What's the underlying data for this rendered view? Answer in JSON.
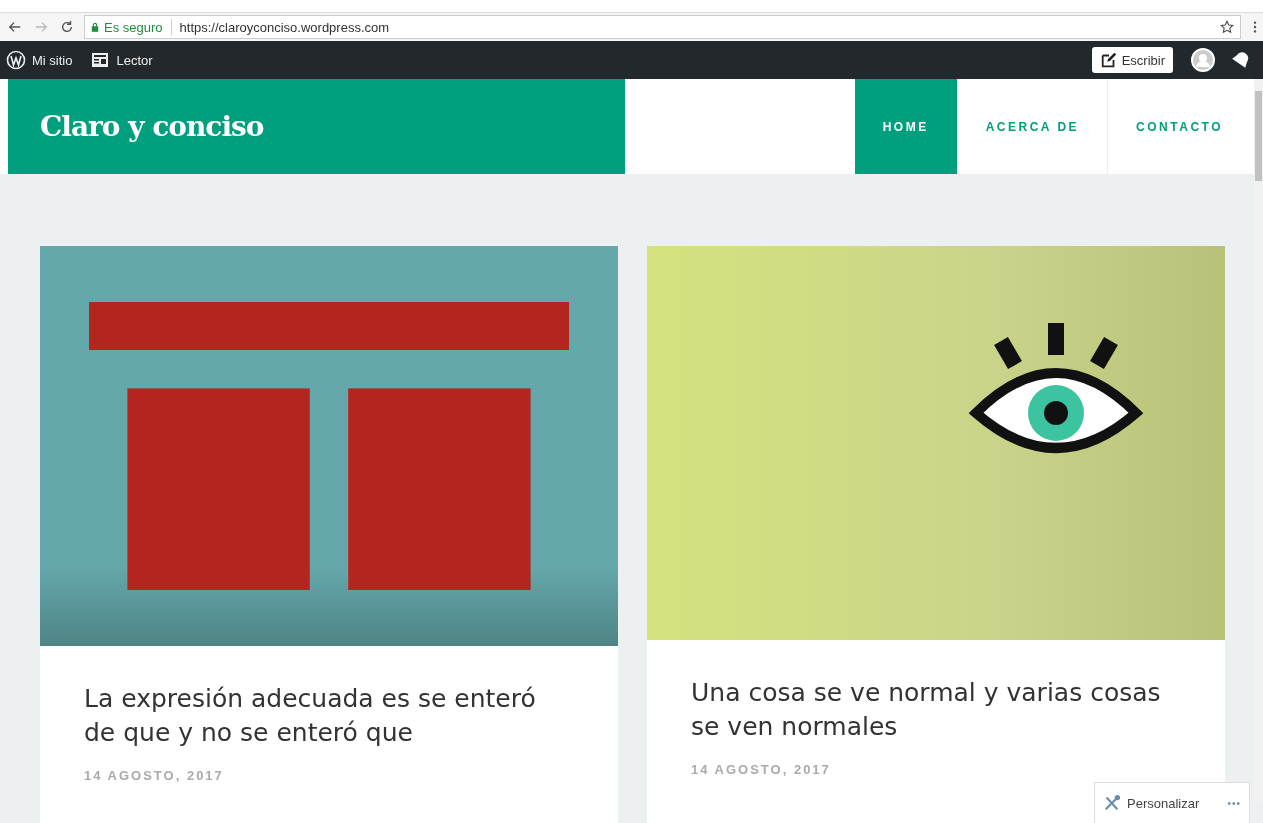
{
  "browser": {
    "secure_label": "Es seguro",
    "url": "https://claroyconciso.wordpress.com",
    "bookmarked": false
  },
  "admin_bar": {
    "left": [
      {
        "kind": "wordpress",
        "label": "Mi sitio"
      },
      {
        "kind": "reader",
        "label": "Lector"
      }
    ],
    "write_button": "Escribir"
  },
  "site": {
    "title": "Claro y conciso",
    "nav": [
      {
        "label": "HOME",
        "selected": true
      },
      {
        "label": "ACERCA DE",
        "selected": false
      },
      {
        "label": "CONTACTO",
        "selected": false
      }
    ]
  },
  "posts": [
    {
      "kind": "enterarse",
      "title": "La expresión adecuada es se enteró de que y no se enteró que",
      "date": "14 AGOSTO, 2017"
    },
    {
      "kind": "eye",
      "title": "Una cosa se ve normal y varias cosas se ven normales",
      "date": "14 AGOSTO, 2017"
    }
  ],
  "customize": {
    "label": "Personalizar",
    "more": "•••"
  }
}
